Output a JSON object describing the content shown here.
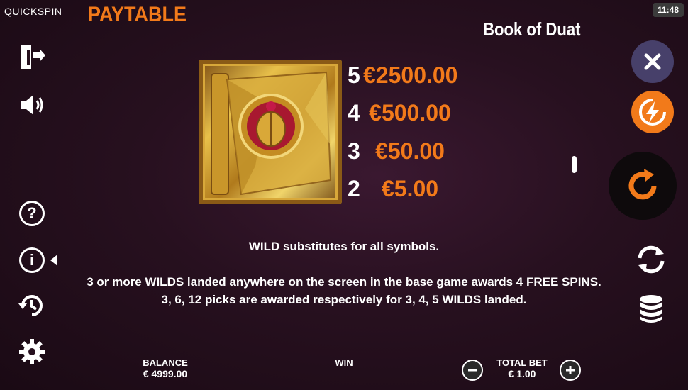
{
  "header": {
    "brand": "QUICKSPIN",
    "section_title": "PAYTABLE",
    "clock": "11:48",
    "game_title": "Book of Duat"
  },
  "paytable": {
    "symbol_icon": "book-of-duat-wild-symbol",
    "rows": [
      {
        "count": "5",
        "value": "€2500.00"
      },
      {
        "count": "4",
        "value": "€500.00"
      },
      {
        "count": "3",
        "value": "€50.00"
      },
      {
        "count": "2",
        "value": "€5.00"
      }
    ]
  },
  "description": {
    "line1": "WILD substitutes for all symbols.",
    "line2": "3 or more WILDS landed anywhere on the screen in the base game awards 4 FREE SPINS.",
    "line3": "3, 6, 12 picks are awarded respectively for 3, 4, 5 WILDS landed."
  },
  "footer": {
    "balance_label": "BALANCE",
    "balance_value": "€ 4999.00",
    "win_label": "WIN",
    "total_bet_label": "TOTAL BET",
    "total_bet_value": "€ 1.00"
  },
  "colors": {
    "accent": "#f27a1a",
    "close_button": "#47406a",
    "background": "#27101f"
  }
}
